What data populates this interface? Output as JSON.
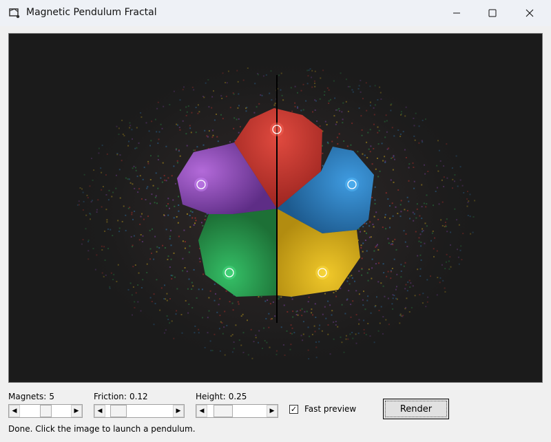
{
  "window": {
    "title": "Magnetic Pendulum Fractal",
    "minimize_icon": "minimize-icon",
    "maximize_icon": "maximize-icon",
    "close_icon": "close-icon"
  },
  "magnets": [
    {
      "name": "red",
      "color": "#c8322d"
    },
    {
      "name": "blue",
      "color": "#2e7fbf"
    },
    {
      "name": "yellow",
      "color": "#d9b21c"
    },
    {
      "name": "green",
      "color": "#2b9a4a"
    },
    {
      "name": "purple",
      "color": "#8a46b0"
    }
  ],
  "controls": {
    "magnets": {
      "label": "Magnets:",
      "value": "5",
      "level": 0.5
    },
    "friction": {
      "label": "Friction:",
      "value": "0.12",
      "level": 0.1
    },
    "height": {
      "label": "Height:",
      "value": "0.25",
      "level": 0.15
    },
    "fast_preview": {
      "label": "Fast preview",
      "checked": true
    },
    "render_button": "Render"
  },
  "status": "Done. Click the image to launch a pendulum."
}
